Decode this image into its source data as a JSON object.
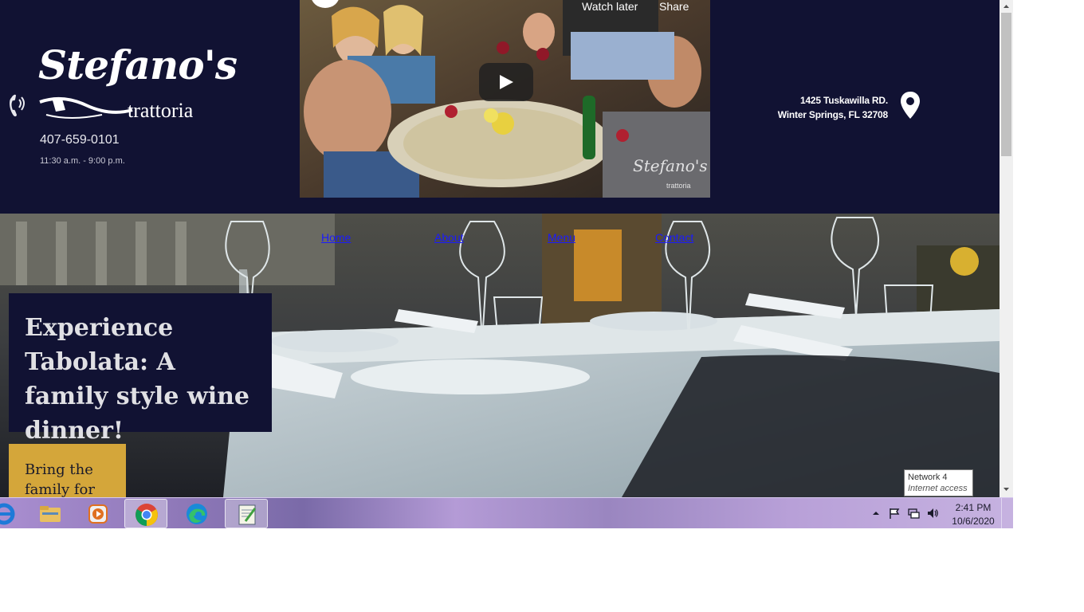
{
  "header": {
    "logo_script": "Stefano's",
    "logo_sub": "trattoria",
    "phone": "407-659-0101",
    "hours": "11:30 a.m. - 9:00 p.m.",
    "address_line1": "1425 Tuskawilla RD.",
    "address_line2": "Winter Springs, FL 32708"
  },
  "video": {
    "watch_later": "Watch later",
    "share": "Share",
    "watermark": "Stefano's",
    "watermark_sub": "trattoria"
  },
  "nav": {
    "items": [
      {
        "label": "Home"
      },
      {
        "label": "About"
      },
      {
        "label": "Menu"
      },
      {
        "label": "Contact"
      }
    ]
  },
  "hero": {
    "event_title": "Experience Tabolata: A family style wine dinner!",
    "cta_text": "Bring the family for"
  },
  "tooltip": {
    "title": "Network  4",
    "subtitle": "Internet access"
  },
  "taskbar": {
    "time": "2:41 PM",
    "date": "10/6/2020",
    "apps": [
      "internet-explorer",
      "file-explorer",
      "media-player",
      "chrome",
      "edge",
      "notepad-app"
    ]
  },
  "colors": {
    "header_bg": "#111233",
    "cta_gold": "#d4a63a",
    "nav_link": "#1a1aff"
  }
}
